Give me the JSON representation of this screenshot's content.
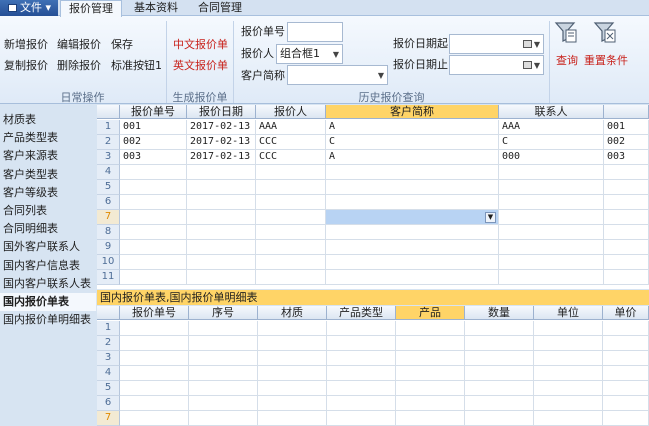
{
  "menu": {
    "file_label": "文件",
    "tabs": [
      "报价管理",
      "基本资料",
      "合同管理"
    ]
  },
  "ribbon": {
    "daily": {
      "new_quote": "新增报价",
      "copy_quote": "复制报价",
      "edit_quote": "编辑报价",
      "delete_quote": "删除报价",
      "save": "保存",
      "standard_button": "标准按钮1",
      "group_label": "日常操作"
    },
    "generate": {
      "cn_quote": "中文报价单",
      "en_quote": "英文报价单",
      "group_label": "生成报价单"
    },
    "history": {
      "quote_no_label": "报价单号",
      "quote_no_value": "",
      "quoter_label": "报价人",
      "quoter_value": "组合框1",
      "customer_label": "客户简称",
      "customer_value": "",
      "date_start_label": "报价日期起",
      "date_end_label": "报价日期止",
      "group_label": "历史报价查询"
    },
    "query_label": "查询",
    "reset_label": "重置条件"
  },
  "sidebar": {
    "items": [
      "材质表",
      "产品类型表",
      "客户来源表",
      "客户类型表",
      "客户等级表",
      "合同列表",
      "合同明细表",
      "国外客户联系人",
      "国内客户信息表",
      "国内客户联系人表",
      "国内报价单表",
      "国内报价单明细表"
    ],
    "active_index": 10
  },
  "top_grid": {
    "headers": [
      "报价单号",
      "报价日期",
      "报价人",
      "客户简称",
      "联系人",
      ""
    ],
    "rows": [
      [
        "001",
        "2017-02-13",
        "AAA",
        "A",
        "AAA",
        "001"
      ],
      [
        "002",
        "2017-02-13",
        "CCC",
        "C",
        "C",
        "002"
      ],
      [
        "003",
        "2017-02-13",
        "CCC",
        "A",
        "000",
        "003"
      ]
    ],
    "row_numbers": [
      "1",
      "2",
      "3",
      "4",
      "5",
      "6",
      "7",
      "8",
      "9",
      "10",
      "11"
    ],
    "selected_row": "7",
    "selected_column": "客户简称"
  },
  "caption": "国内报价单表,国内报价单明细表",
  "bottom_grid": {
    "headers": [
      "报价单号",
      "序号",
      "材质",
      "产品类型",
      "产品",
      "数量",
      "单位",
      "单价"
    ],
    "row_numbers": [
      "1",
      "2",
      "3",
      "4",
      "5",
      "6",
      "7"
    ],
    "selected_row": "7",
    "selected_column": "产品"
  },
  "colors": {
    "accent_red": "#c8211b",
    "header_highlight": "#ffd467",
    "selection_blue": "#b8d3f3"
  }
}
